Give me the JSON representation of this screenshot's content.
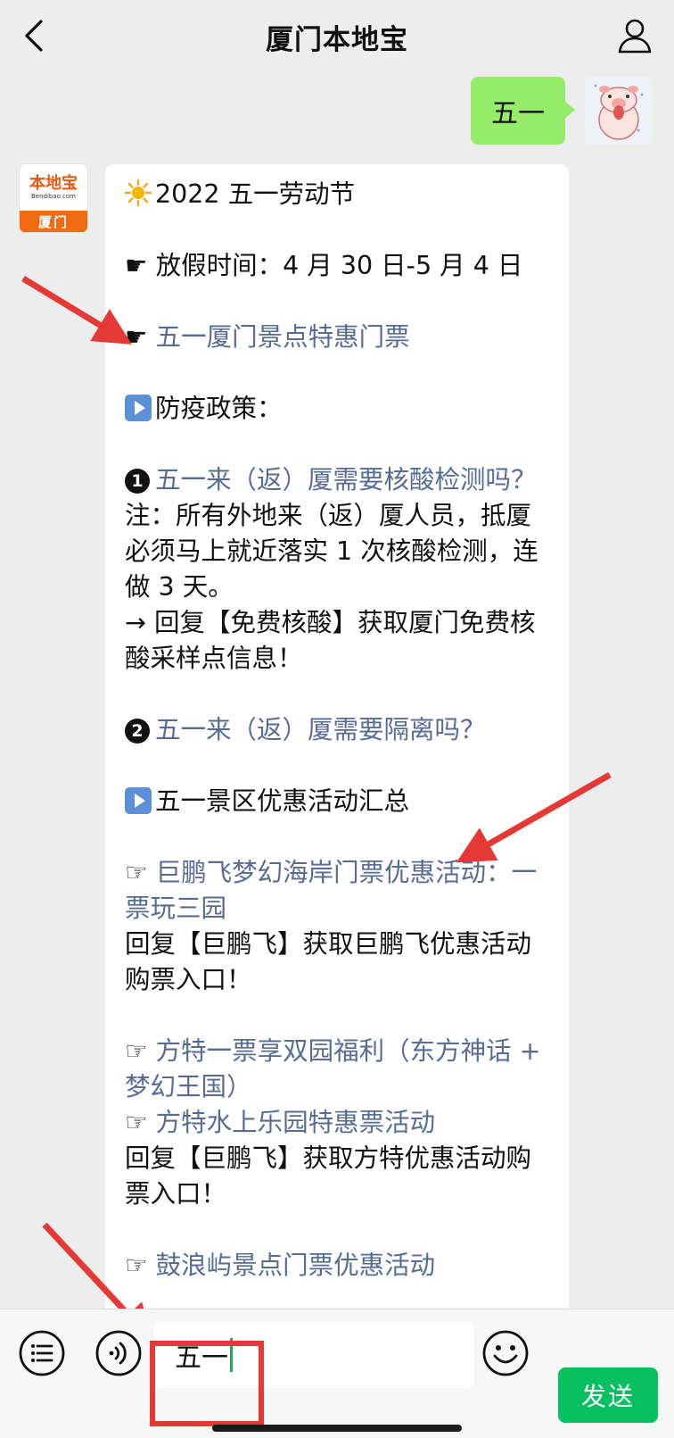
{
  "header": {
    "title": "厦门本地宝"
  },
  "user_message": {
    "text": "五一"
  },
  "bot_avatar": {
    "brand": "本地宝",
    "domain": "Bendibao.com",
    "city": "厦门"
  },
  "bot_message": {
    "headline": "2022 五一劳动节",
    "holiday": "放假时间：4 月 30 日-5 月 4 日",
    "ticket_link": "五一厦门景点特惠门票",
    "policy_heading": "防疫政策：",
    "q1_link": "五一来（返）厦需要核酸检测吗？",
    "q1_note": "注：所有外地来（返）厦人员，抵厦必须马上就近落实 1 次核酸检测，连做 3 天。",
    "q1_reply": "→ 回复【免费核酸】获取厦门免费核酸采样点信息！",
    "q2_link": "五一来（返）厦需要隔离吗？",
    "deals_heading": "五一景区优惠活动汇总",
    "deal1_link": "巨鹏飞梦幻海岸门票优惠活动：一票玩三园",
    "deal1_reply": "回复【巨鹏飞】获取巨鹏飞优惠活动购票入口！",
    "deal2_link": "方特一票享双园福利（东方神话 + 梦幻王国）",
    "deal3_link": "方特水上乐园特惠票活动",
    "deal23_reply": "回复【巨鹏飞】获取方特优惠活动购票入口！",
    "deal4_link": "鼓浪屿景点门票优惠活动"
  },
  "input": {
    "value": "五一"
  },
  "send_label": "发送",
  "icons": {
    "back": "chevron-left-icon",
    "profile": "person-icon",
    "menu": "list-icon",
    "voice": "voice-icon",
    "emoji": "emoji-icon",
    "sun": "sun-icon",
    "pointer": "hand-pointer-icon",
    "play": "play-icon"
  },
  "colors": {
    "background": "#ededed",
    "user_bubble": "#95ec69",
    "link": "#576b95",
    "send_button": "#07c160",
    "annotation": "#e53935",
    "brand_orange": "#f06a12"
  }
}
